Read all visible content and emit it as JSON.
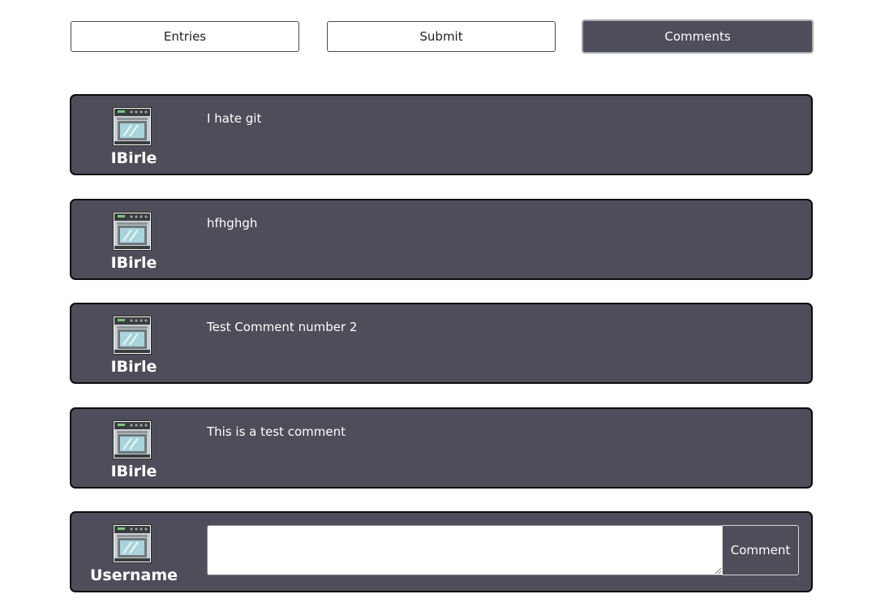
{
  "nav": {
    "entries_label": "Entries",
    "submit_label": "Submit",
    "comments_label": "Comments",
    "active": "Comments"
  },
  "comments": [
    {
      "username": "IBirle",
      "text": "I hate git",
      "avatar_icon": "oven-icon"
    },
    {
      "username": "IBirle",
      "text": "hfhghgh",
      "avatar_icon": "oven-icon"
    },
    {
      "username": "IBirle",
      "text": "Test Comment number 2",
      "avatar_icon": "oven-icon"
    },
    {
      "username": "IBirle",
      "text": "This is a test comment",
      "avatar_icon": "oven-icon"
    }
  ],
  "composer": {
    "username": "Username",
    "avatar_icon": "oven-icon",
    "input_value": "",
    "button_label": "Comment"
  },
  "colors": {
    "card_background": "#4e4e5a",
    "card_border": "#0c0c0f",
    "text_light": "#ffffff"
  }
}
